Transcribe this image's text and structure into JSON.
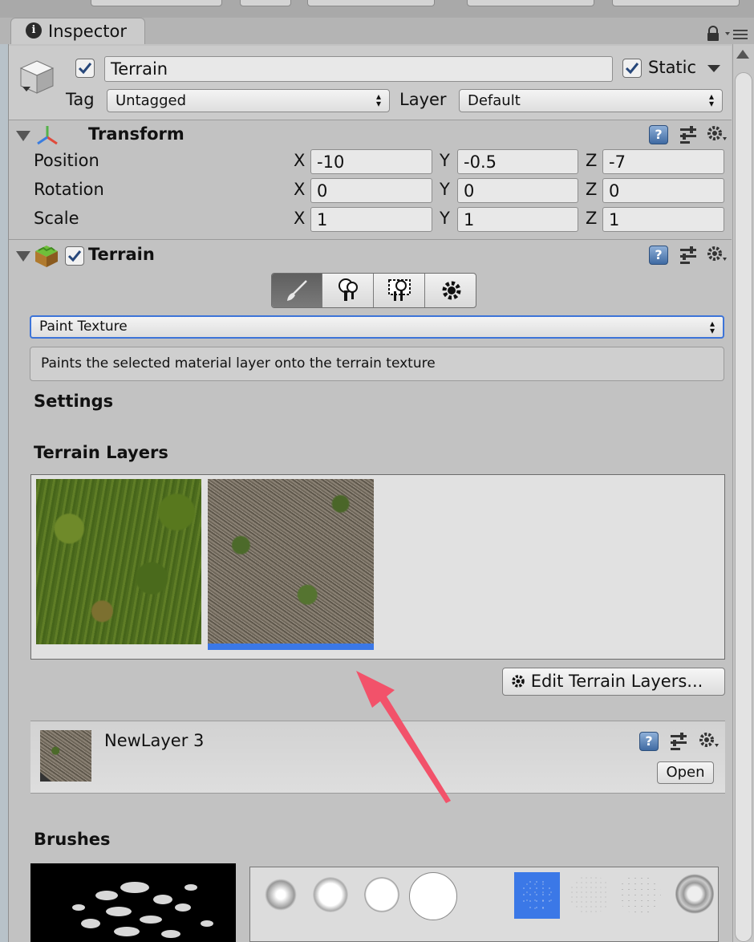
{
  "tab": {
    "label": "Inspector"
  },
  "object": {
    "name": "Terrain",
    "static_label": "Static",
    "active": true,
    "static": true
  },
  "tag": {
    "label": "Tag",
    "value": "Untagged"
  },
  "layer": {
    "label": "Layer",
    "value": "Default"
  },
  "transform": {
    "title": "Transform",
    "rows": [
      {
        "label": "Position",
        "x": "-10",
        "y": "-0.5",
        "z": "-7"
      },
      {
        "label": "Rotation",
        "x": "0",
        "y": "0",
        "z": "0"
      },
      {
        "label": "Scale",
        "x": "1",
        "y": "1",
        "z": "1"
      }
    ],
    "axis": {
      "x": "X",
      "y": "Y",
      "z": "Z"
    }
  },
  "terrain": {
    "title": "Terrain",
    "enabled": true,
    "tool_dropdown": "Paint Texture",
    "help_text": "Paints the selected material layer onto the terrain texture",
    "settings_heading": "Settings",
    "layers_heading": "Terrain Layers",
    "selected_layer_index": 1,
    "edit_layers_button": "Edit Terrain Layers...",
    "layer_name": "NewLayer 3",
    "open_button": "Open",
    "brushes_heading": "Brushes"
  },
  "colors": {
    "selection": "#3b78e7",
    "annotation_arrow": "#f2526a"
  }
}
